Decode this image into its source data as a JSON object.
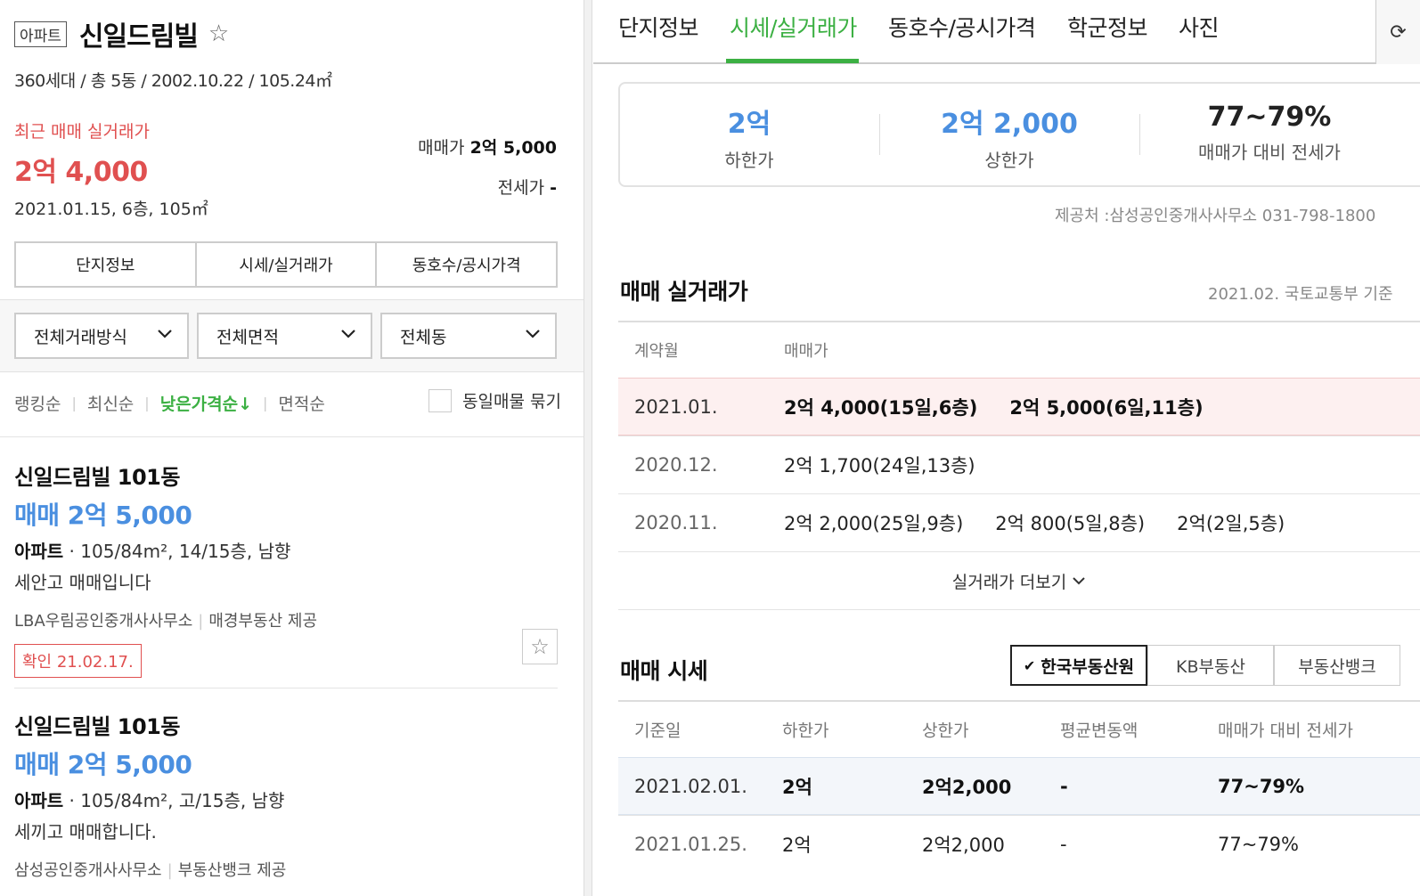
{
  "complex": {
    "type_badge": "아파트",
    "name": "신일드림빌",
    "info": "360세대 / 총 5동 / 2002.10.22 / 105.24㎡"
  },
  "recent": {
    "label": "최근 매매 실거래가",
    "price": "2억 4,000",
    "meta": "2021.01.15, 6층, 105㎡",
    "sale_label": "매매가",
    "sale_value": "2억 5,000",
    "jeonse_label": "전세가",
    "jeonse_value": "-"
  },
  "left_tabs": [
    "단지정보",
    "시세/실거래가",
    "동호수/공시가격"
  ],
  "filters": [
    "전체거래방식",
    "전체면적",
    "전체동"
  ],
  "sort": {
    "items": [
      "랭킹순",
      "최신순",
      "낮은가격순↓",
      "면적순"
    ],
    "active_index": 2,
    "same_listing_label": "동일매물 묶기"
  },
  "listings": [
    {
      "name": "신일드림빌 101동",
      "price": "매매 2억 5,000",
      "type": "아파트",
      "spec": " · 105/84m², 14/15층, 남향",
      "desc": "세안고 매매입니다",
      "agent": "LBA우림공인중개사사무소",
      "provider": "매경부동산 제공",
      "badge": "확인 21.02.17."
    },
    {
      "name": "신일드림빌 101동",
      "price": "매매 2억 5,000",
      "type": "아파트",
      "spec": " · 105/84m², 고/15층, 남향",
      "desc": "세끼고 매매합니다.",
      "agent": "삼성공인중개사사무소",
      "provider": "부동산뱅크 제공",
      "badge": ""
    }
  ],
  "top_tabs": [
    "단지정보",
    "시세/실거래가",
    "동호수/공시가격",
    "학군정보",
    "사진"
  ],
  "top_tab_active": 1,
  "refresh_icon": "refresh-icon",
  "summary": [
    {
      "value": "2억",
      "label": "하한가"
    },
    {
      "value": "2억 2,000",
      "label": "상한가"
    },
    {
      "value": "77~79%",
      "label": "매매가 대비 전세가"
    }
  ],
  "provider_text": "제공처 :삼성공인중개사사무소 031-798-1800",
  "transactions": {
    "title": "매매 실거래가",
    "note": "2021.02. 국토교통부 기준",
    "headers": [
      "계약월",
      "매매가"
    ],
    "rows": [
      {
        "month": "2021.01.",
        "deals": [
          "2억 4,000(15일,6층)",
          "2억 5,000(6일,11층)"
        ]
      },
      {
        "month": "2020.12.",
        "deals": [
          "2억 1,700(24일,13층)"
        ]
      },
      {
        "month": "2020.11.",
        "deals": [
          "2억 2,000(25일,9층)",
          "2억 800(5일,8층)",
          "2억(2일,5층)"
        ]
      }
    ],
    "more_label": "실거래가 더보기"
  },
  "market": {
    "title": "매매 시세",
    "sources": [
      "한국부동산원",
      "KB부동산",
      "부동산뱅크"
    ],
    "active_source": 0,
    "headers": [
      "기준일",
      "하한가",
      "상한가",
      "평균변동액",
      "매매가 대비 전세가"
    ],
    "rows": [
      [
        "2021.02.01.",
        "2억",
        "2억2,000",
        "-",
        "77~79%"
      ],
      [
        "2021.01.25.",
        "2억",
        "2억2,000",
        "-",
        "77~79%"
      ]
    ]
  },
  "colors": {
    "accent_green": "#3cb043",
    "price_red": "#e05050",
    "price_blue": "#4a8fe0"
  }
}
